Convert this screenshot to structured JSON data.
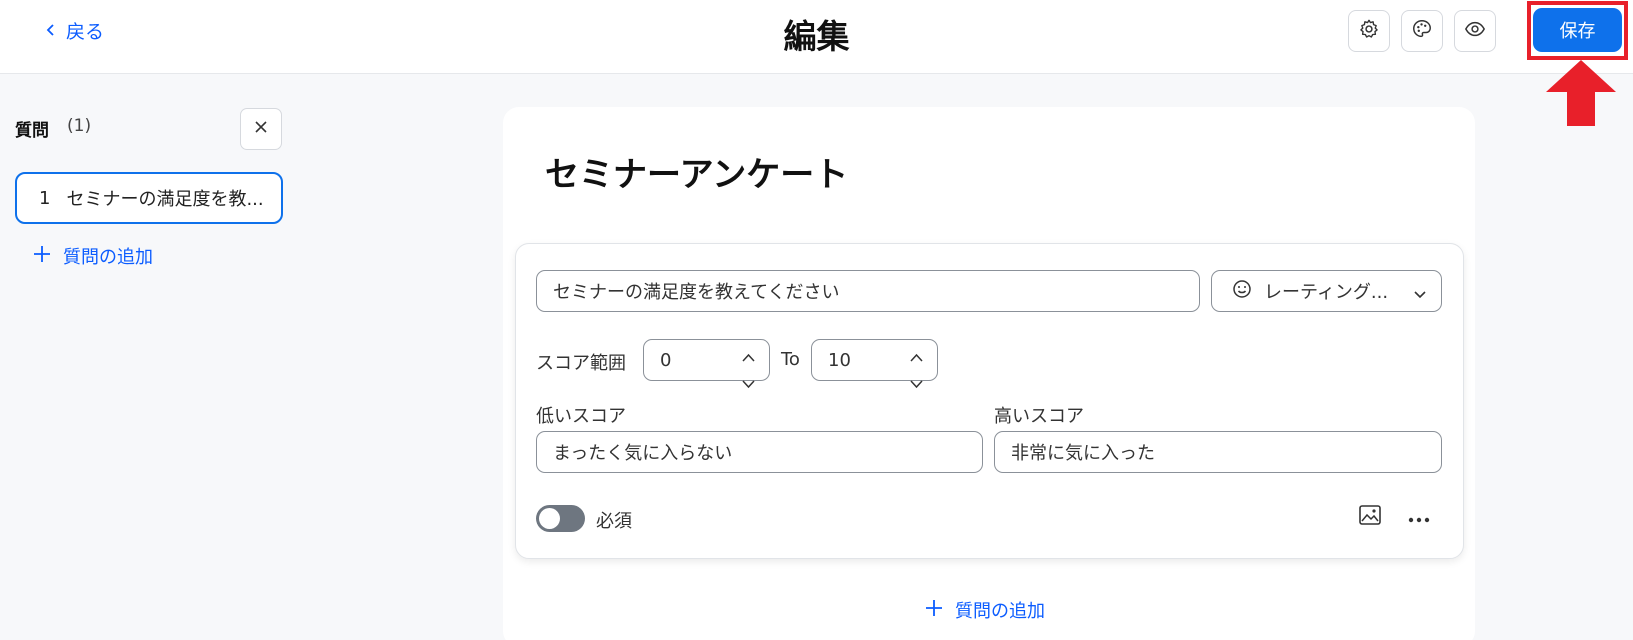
{
  "header": {
    "back_label": "戻る",
    "title": "編集",
    "icons": [
      "gear-icon",
      "palette-icon",
      "eye-icon"
    ],
    "save_label": "保存",
    "accent_color": "#0e71eb",
    "highlight_color": "#e8202a"
  },
  "sidebar": {
    "title": "質問",
    "count": "(1)",
    "items": [
      {
        "number": "1",
        "label": "セミナーの満足度を教..."
      }
    ],
    "add_label": "質問の追加"
  },
  "main": {
    "survey_title": "セミナーアンケート",
    "question": {
      "text": "セミナーの満足度を教えてください",
      "type_label": "レーティング...",
      "score_range_label": "スコア範囲",
      "score_min": "0",
      "to_label": "To",
      "score_max": "10",
      "low_label": "低いスコア",
      "low_value": "まったく気に入らない",
      "high_label": "高いスコア",
      "high_value": "非常に気に入った",
      "required_label": "必須",
      "required": false
    },
    "add_label": "質問の追加"
  }
}
